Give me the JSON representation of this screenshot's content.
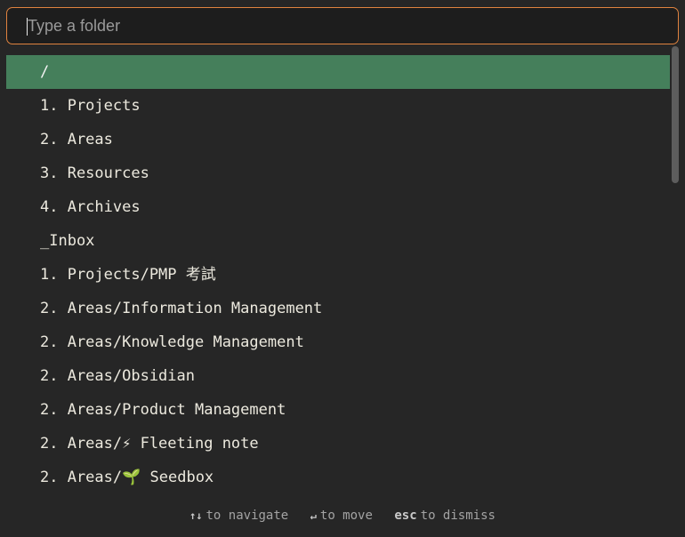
{
  "search": {
    "placeholder": "Type a folder",
    "value": ""
  },
  "items": [
    {
      "label": "/"
    },
    {
      "label": "1. Projects"
    },
    {
      "label": "2. Areas"
    },
    {
      "label": "3. Resources"
    },
    {
      "label": "4. Archives"
    },
    {
      "label": "_Inbox"
    },
    {
      "label": "1. Projects/PMP 考試"
    },
    {
      "label": "2. Areas/Information Management"
    },
    {
      "label": "2. Areas/Knowledge Management"
    },
    {
      "label": "2. Areas/Obsidian"
    },
    {
      "label": "2. Areas/Product Management"
    },
    {
      "label": "2. Areas/⚡ Fleeting note"
    },
    {
      "label": "2. Areas/🌱 Seedbox"
    }
  ],
  "selected_index": 0,
  "colors": {
    "accent_border": "#e0833f",
    "selected_bg": "#457f5b",
    "background": "#262626"
  },
  "footer": {
    "navigate_key": "↑↓",
    "navigate_label": "to navigate",
    "move_key": "↵",
    "move_label": "to move",
    "dismiss_key": "esc",
    "dismiss_label": "to dismiss"
  }
}
